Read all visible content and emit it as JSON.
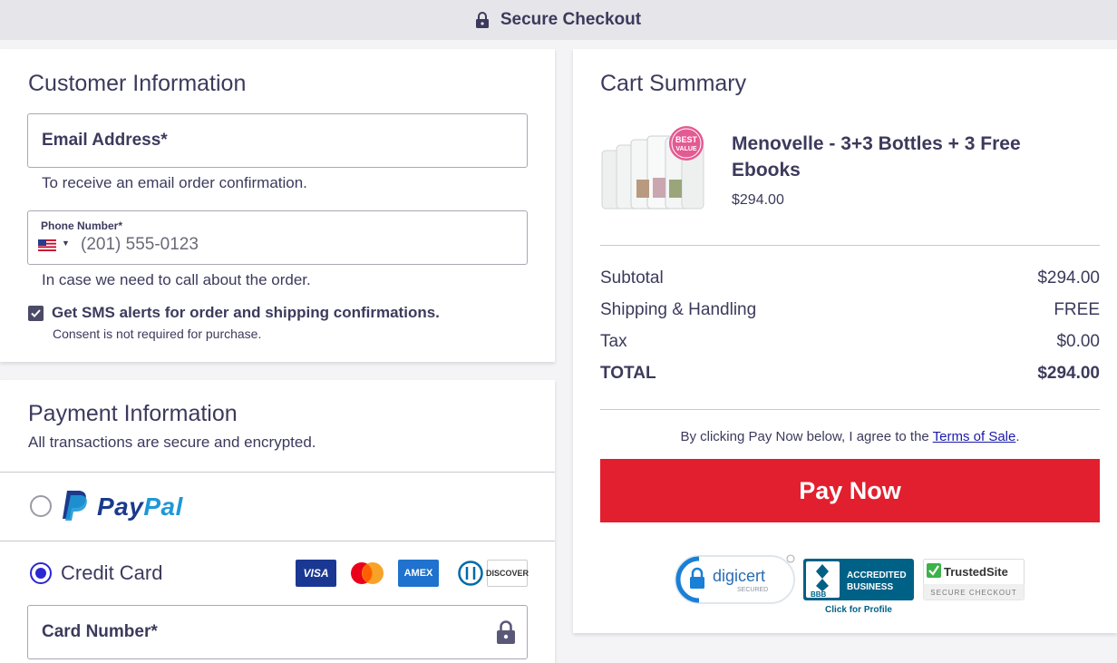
{
  "header": {
    "title": "Secure Checkout"
  },
  "customer": {
    "title": "Customer Information",
    "email_label": "Email Address*",
    "email_hint": "To receive an email order confirmation.",
    "phone_label": "Phone Number*",
    "phone_placeholder": "(201) 555-0123",
    "phone_hint": "In case we need to call about the order.",
    "sms_label": "Get SMS alerts for order and shipping confirmations.",
    "sms_checked": true,
    "consent": "Consent is not required for purchase."
  },
  "payment": {
    "title": "Payment Information",
    "note": "All transactions are secure and encrypted.",
    "paypal_pay": "Pay",
    "paypal_pal": "Pal",
    "credit_card_label": "Credit Card",
    "credit_card_selected": true,
    "card_logos": [
      "VISA",
      "Mastercard",
      "AMEX",
      "Diners",
      "DISCOVER"
    ],
    "card_number_label": "Card Number*"
  },
  "summary": {
    "title": "Cart Summary",
    "product_badge": [
      "BEST",
      "VALUE"
    ],
    "product_name": "Menovelle - 3+3 Bottles + 3 Free Ebooks",
    "product_price": "$294.00",
    "rows": [
      {
        "label": "Subtotal",
        "value": "$294.00"
      },
      {
        "label": "Shipping & Handling",
        "value": "FREE"
      },
      {
        "label": "Tax",
        "value": "$0.00"
      },
      {
        "label": "TOTAL",
        "value": "$294.00"
      }
    ],
    "agree_text": "By clicking Pay Now below, I agree to the ",
    "terms_link": "Terms of Sale",
    "agree_end": ".",
    "pay_button": "Pay Now"
  },
  "badges": {
    "digicert": "digicert",
    "digicert_sub": "SECURED",
    "bbb_line1": "ACCREDITED",
    "bbb_line2": "BUSINESS",
    "bbb_logo": "BBB",
    "bbb_caption": "Click for Profile",
    "trusted": "TrustedSite",
    "trusted_sub": "SECURE CHECKOUT"
  },
  "colors": {
    "accent": "#2b27d4",
    "pay_button": "#e21f2e",
    "text": "#3c3a5c"
  }
}
